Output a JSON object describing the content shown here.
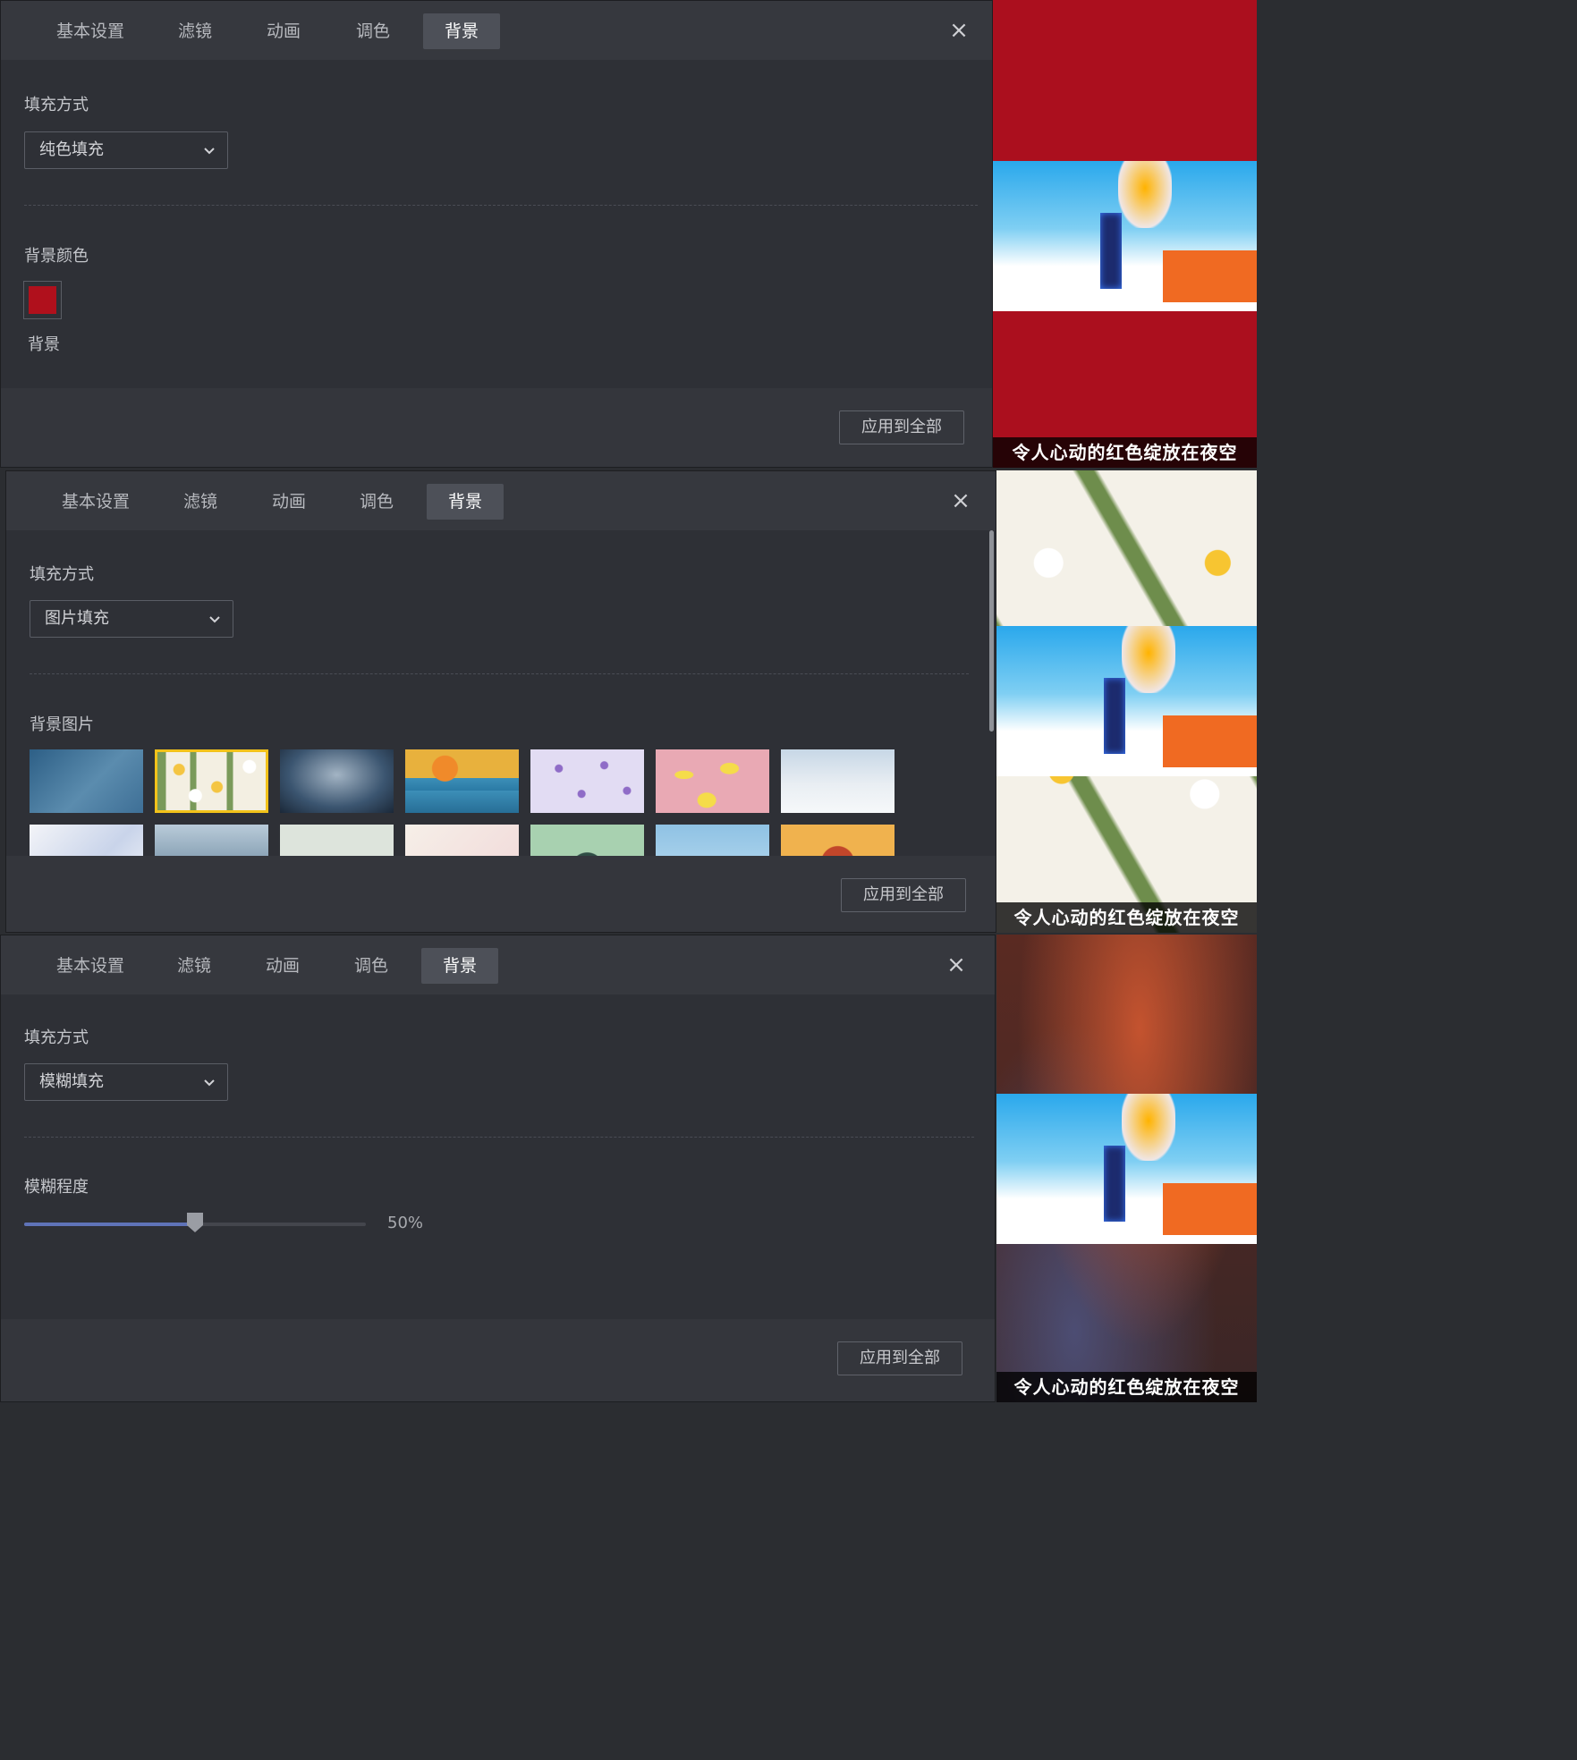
{
  "tabs": [
    "基本设置",
    "滤镜",
    "动画",
    "调色",
    "背景"
  ],
  "active_tab": "背景",
  "close_glyph": "×",
  "apply_label": "应用到全部",
  "fill_label": "填充方式",
  "dropdown_icon": "chevron-down-icon",
  "panel1": {
    "fill_value": "纯色填充",
    "section_label": "背景颜色",
    "swatch_caption": "背景",
    "swatch_color": "#b0101c"
  },
  "panel2": {
    "fill_value": "图片填充",
    "section_label": "背景图片",
    "selected_thumb_index": 1,
    "thumbnails": [
      "paper-boat-on-blue-water",
      "daisy-flower-pattern",
      "night-sky-lone-figure",
      "sun-over-waves-boat",
      "purple-hearts-pattern",
      "lemon-pattern-pink",
      "snowy-landscape",
      "light-blue-wash",
      "blue-mountains",
      "pale-green-minimal",
      "merry-christmas",
      "green-plate-setting",
      "blue-sky-clouds",
      "autumn-fruit-heart"
    ]
  },
  "panel3": {
    "fill_value": "模糊填充",
    "section_label": "模糊程度",
    "blur_value_text": "50%",
    "blur_level": 0.5
  },
  "preview": {
    "caption": "令人心动的红色绽放在夜空",
    "backgrounds": [
      "solid-red",
      "daisy-flower-pattern",
      "blurred-video-frame"
    ]
  },
  "colors": {
    "accent_selected": "#f2c21a",
    "slider_fill": "#5f73b8",
    "solid_red": "#ab0f1e"
  }
}
